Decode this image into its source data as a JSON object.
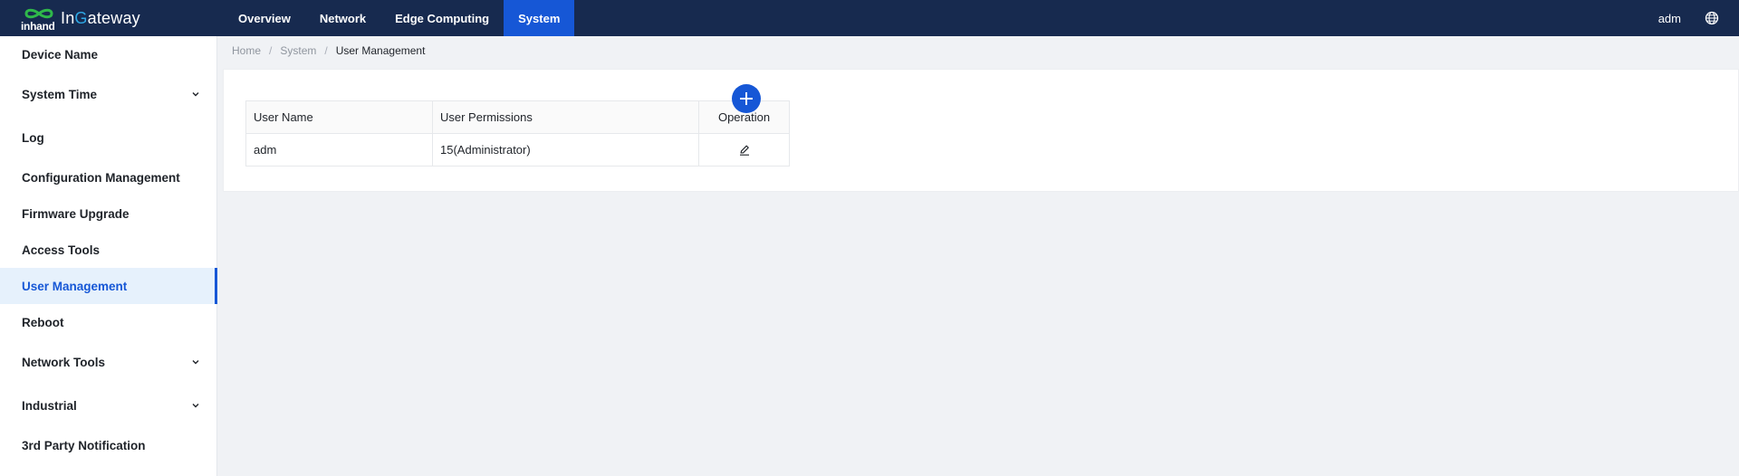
{
  "header": {
    "logo_brand": "inhand",
    "logo_product_prefix": "In",
    "logo_product_g": "G",
    "logo_product_suffix": "ateway",
    "nav": [
      {
        "label": "Overview",
        "active": false
      },
      {
        "label": "Network",
        "active": false
      },
      {
        "label": "Edge Computing",
        "active": false
      },
      {
        "label": "System",
        "active": true
      }
    ],
    "user": "adm",
    "icons": {
      "language": "globe-icon"
    }
  },
  "sidebar": {
    "items": [
      {
        "label": "Device Name",
        "expandable": false
      },
      {
        "label": "System Time",
        "expandable": true
      },
      {
        "label": "Log",
        "expandable": false
      },
      {
        "label": "Configuration Management",
        "expandable": false
      },
      {
        "label": "Firmware Upgrade",
        "expandable": false
      },
      {
        "label": "Access Tools",
        "expandable": false
      },
      {
        "label": "User Management",
        "expandable": false,
        "active": true
      },
      {
        "label": "Reboot",
        "expandable": false
      },
      {
        "label": "Network Tools",
        "expandable": true
      },
      {
        "label": "Industrial",
        "expandable": true
      },
      {
        "label": "3rd Party Notification",
        "expandable": false
      }
    ]
  },
  "breadcrumb": {
    "home": "Home",
    "section": "System",
    "current": "User Management",
    "separator": "/"
  },
  "table": {
    "columns": [
      "User Name",
      "User Permissions",
      "Operation"
    ],
    "rows": [
      {
        "user_name": "adm",
        "permissions": "15(Administrator)",
        "operation_icon": "edit-icon"
      }
    ],
    "add_icon": "plus-icon"
  },
  "colors": {
    "topbar": "#172a4f",
    "accent": "#1657d6",
    "sidebar_active_bg": "#e6f1fc",
    "logo_accent": "#2fa8e6"
  }
}
